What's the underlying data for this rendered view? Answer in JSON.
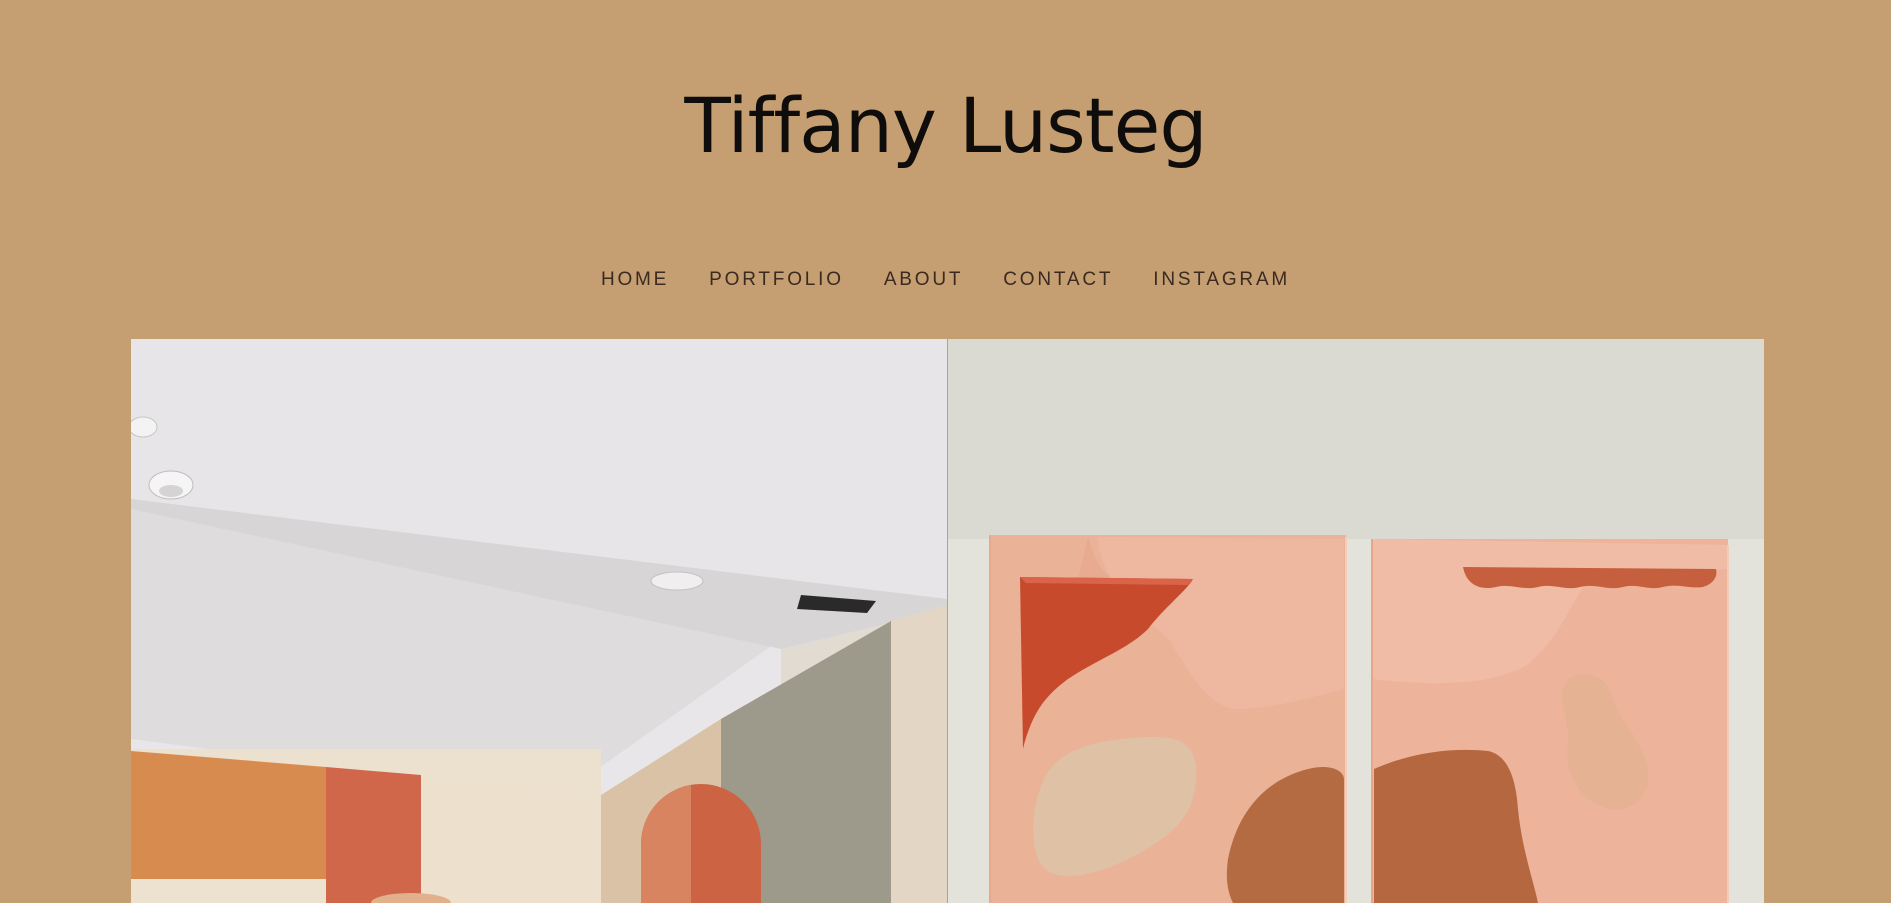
{
  "site": {
    "title": "Tiffany Lusteg"
  },
  "nav": {
    "items": [
      {
        "label": "HOME"
      },
      {
        "label": "PORTFOLIO"
      },
      {
        "label": "ABOUT"
      },
      {
        "label": "CONTACT"
      },
      {
        "label": "INSTAGRAM"
      }
    ]
  },
  "colors": {
    "background": "#c59e72",
    "title_text": "#0f0d0b",
    "nav_text": "#3a2a1f"
  },
  "gallery": {
    "items": [
      {
        "image": "mural-room-photo"
      },
      {
        "image": "relief-wall-art-photo"
      }
    ]
  }
}
